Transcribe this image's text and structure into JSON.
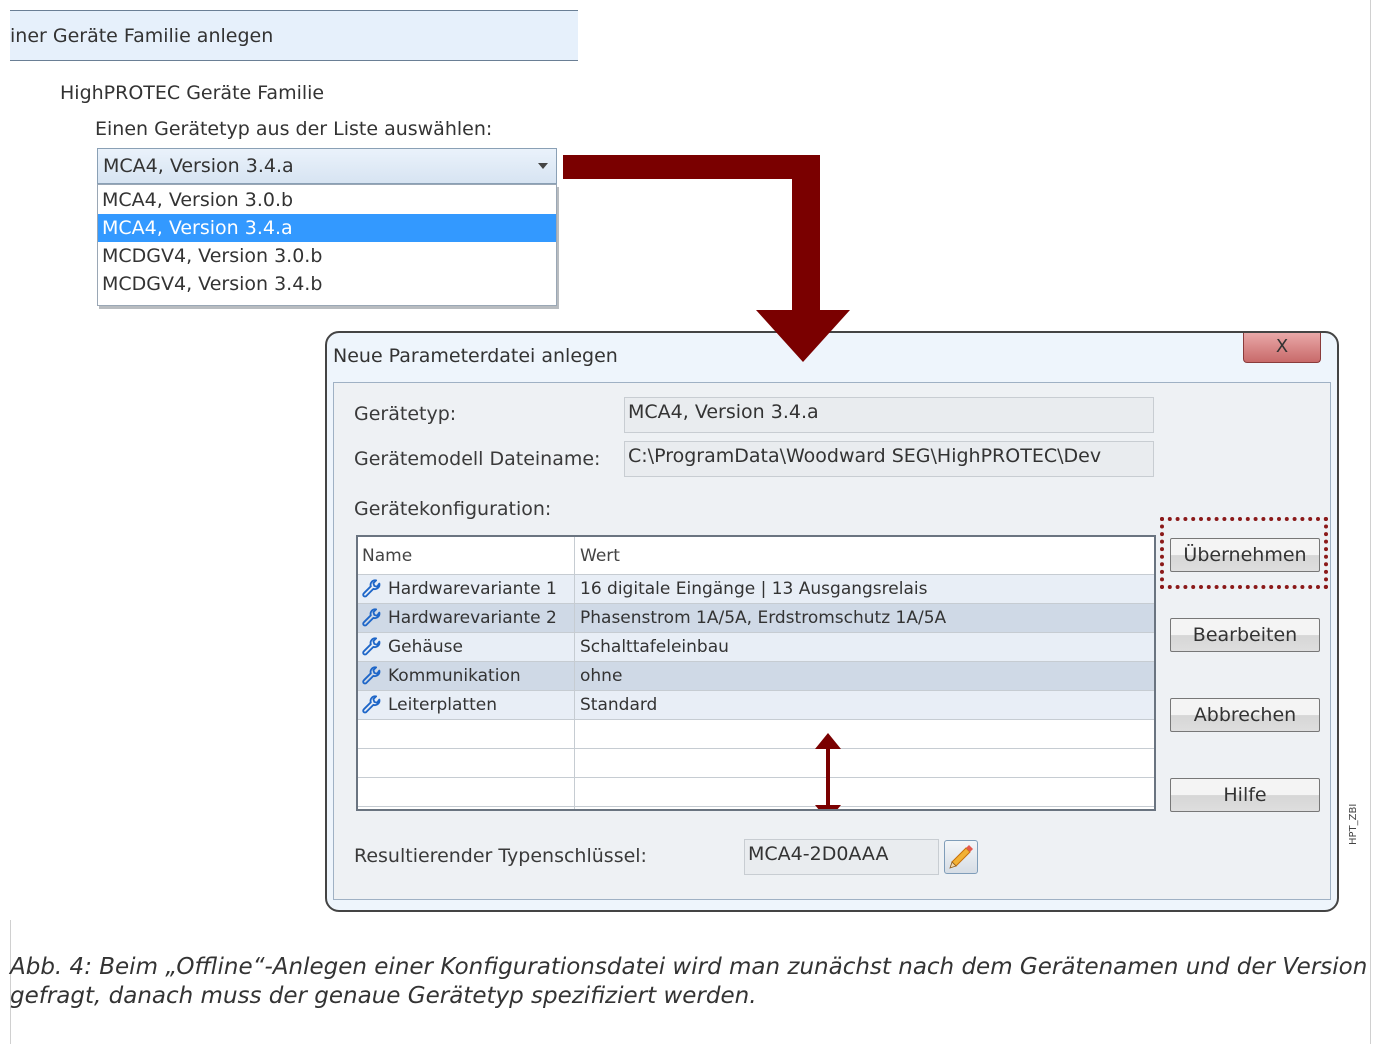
{
  "top_panel": {
    "header": "iner Geräte Familie anlegen",
    "family_label": "HighPROTEC Geräte Familie",
    "choose_label": "Einen Gerätetyp aus der Liste auswählen:",
    "select_value": "MCA4, Version 3.4.a",
    "options": [
      {
        "label": "MCA4, Version 3.0.b",
        "selected": false
      },
      {
        "label": "MCA4, Version 3.4.a",
        "selected": true
      },
      {
        "label": "MCDGV4, Version 3.0.b",
        "selected": false
      },
      {
        "label": "MCDGV4, Version 3.4.b",
        "selected": false
      }
    ]
  },
  "dialog": {
    "title": "Neue Parameterdatei anlegen",
    "close_label": "X",
    "device_type_label": "Gerätetyp:",
    "device_type_value": "MCA4, Version 3.4.a",
    "model_file_label": "Gerätemodell Dateiname:",
    "model_file_value": "C:\\ProgramData\\Woodward SEG\\HighPROTEC\\Dev",
    "config_label": "Gerätekonfiguration:",
    "table": {
      "headers": [
        "Name",
        "Wert"
      ],
      "rows": [
        {
          "name": "Hardwarevariante 1",
          "value": "16 digitale Eingänge | 13 Ausgangsrelais",
          "icon": "wrench-icon"
        },
        {
          "name": "Hardwarevariante 2",
          "value": "Phasenstrom 1A/5A, Erdstromschutz 1A/5A",
          "icon": "wrench-icon"
        },
        {
          "name": "Gehäuse",
          "value": "Schalttafeleinbau",
          "icon": "wrench-icon"
        },
        {
          "name": "Kommunikation",
          "value": "ohne",
          "icon": "wrench-icon"
        },
        {
          "name": "Leiterplatten",
          "value": "Standard",
          "icon": "wrench-icon"
        }
      ]
    },
    "buttons": {
      "apply": "Übernehmen",
      "edit": "Bearbeiten",
      "cancel": "Abbrechen",
      "help": "Hilfe"
    },
    "type_key_label": "Resultierender Typenschlüssel:",
    "type_key_value": "MCA4-2D0AAA",
    "edit_icon": "pencil-icon"
  },
  "side_label": "HPT_ZBI",
  "caption": "Abb. 4: Beim „Offline“-Anlegen einer Konfigurationsdatei wird man zunächst nach dem Gerätenamen und der Version gefragt, danach muss der genaue Gerätetyp spezifiziert werden.",
  "colors": {
    "arrow": "#7a0000",
    "highlight_box": "#8b1a1a",
    "selection": "#3399ff"
  }
}
